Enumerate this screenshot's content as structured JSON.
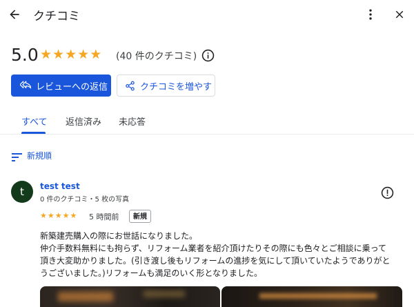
{
  "header": {
    "title": "クチコミ"
  },
  "summary": {
    "rating": "5.0",
    "stars": [
      "★",
      "★",
      "★",
      "★",
      "★"
    ],
    "count_text": "(40 件のクチコミ)"
  },
  "actions": {
    "reply_label": "レビューへの返信",
    "share_label": "クチコミを増やす"
  },
  "tabs": [
    {
      "label": "すべて",
      "selected": true
    },
    {
      "label": "返信済み",
      "selected": false
    },
    {
      "label": "未応答",
      "selected": false
    }
  ],
  "sort": {
    "label": "新規順"
  },
  "review": {
    "avatar_letter": "t",
    "name": "test test",
    "meta": "0 件のクチコミ・5 枚の写真",
    "stars": [
      "★",
      "★",
      "★",
      "★",
      "★"
    ],
    "time": "5 時間前",
    "badge": "新規",
    "text_lines": [
      "新築建売購入の際にお世話になりました。",
      "仲介手数料無料にも拘らず、リフォーム業者を紹介頂けたりその際にも色々とご相談に乗って",
      "頂き大変助かりました。(引き渡し後もリフォームの進捗を気にして頂いていたようでありがと",
      "うございました。)リフォームも満足のいく形となりました。"
    ]
  },
  "colors": {
    "accent": "#1a56db",
    "star": "#f5a623",
    "avatar_bg": "#133a1b"
  }
}
